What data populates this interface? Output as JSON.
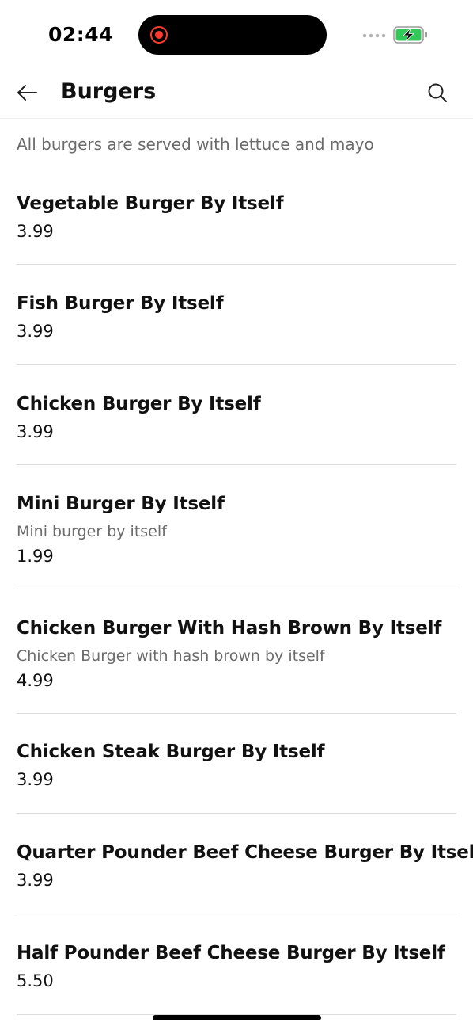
{
  "status_bar": {
    "time": "02:44"
  },
  "header": {
    "title": "Burgers"
  },
  "category": {
    "note": "All burgers are served with lettuce and mayo"
  },
  "items": [
    {
      "name": "Vegetable Burger By Itself",
      "description": "",
      "price": "3.99"
    },
    {
      "name": "Fish Burger By Itself",
      "description": "",
      "price": "3.99"
    },
    {
      "name": "Chicken Burger By Itself",
      "description": "",
      "price": "3.99"
    },
    {
      "name": "Mini Burger By Itself",
      "description": "Mini burger by itself",
      "price": "1.99"
    },
    {
      "name": "Chicken Burger With Hash Brown By Itself",
      "description": "Chicken Burger with hash brown by itself",
      "price": "4.99"
    },
    {
      "name": "Chicken Steak Burger By Itself",
      "description": "",
      "price": "3.99"
    },
    {
      "name": "Quarter Pounder Beef Cheese Burger By Itself",
      "description": "",
      "price": "3.99"
    },
    {
      "name": "Half Pounder Beef Cheese Burger By Itself",
      "description": "",
      "price": "5.50"
    }
  ],
  "icons": {
    "back": "arrow-left-icon",
    "search": "search-icon",
    "recording": "recording-icon",
    "signal": "signal-icon",
    "battery": "battery-charging-icon"
  },
  "colors": {
    "battery_green": "#34c759",
    "recording_red": "#ff3b30",
    "divider": "#dcdcdc",
    "muted_text": "#6b6b6b"
  }
}
